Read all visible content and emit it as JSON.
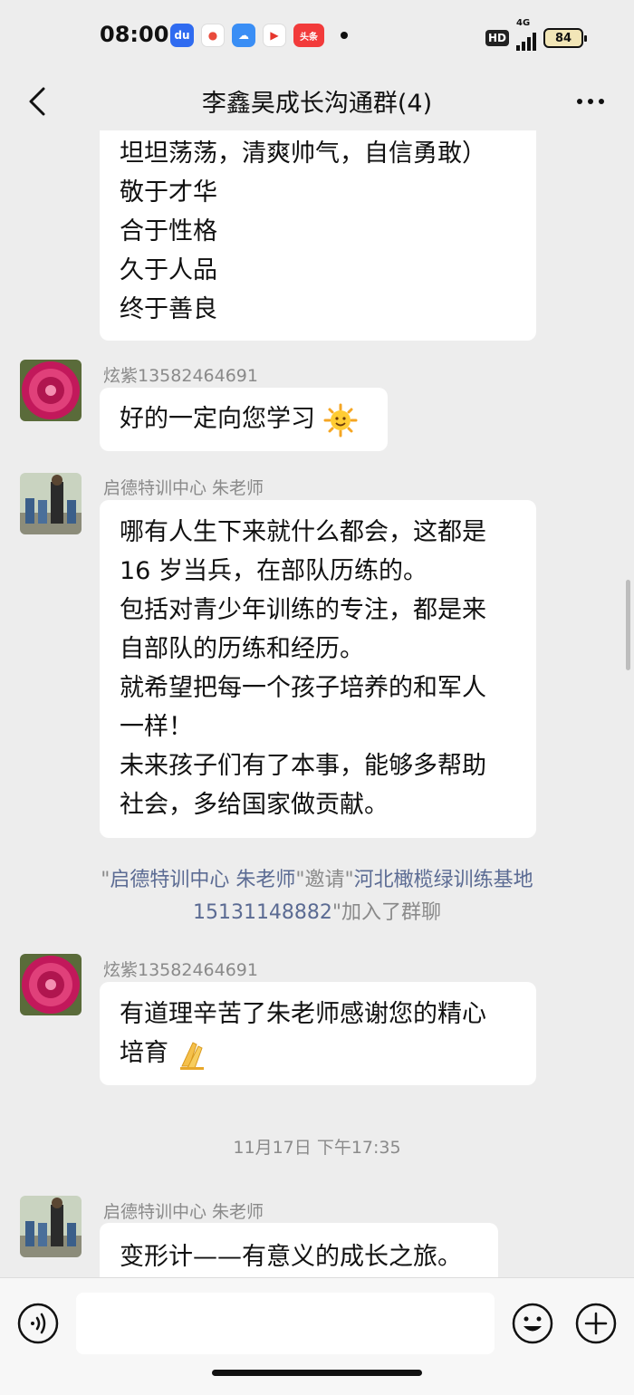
{
  "status_bar": {
    "time": "08:00",
    "app_icons": [
      {
        "name": "baidu-icon",
        "color": "#2f6bf0",
        "glyph": "du"
      },
      {
        "name": "map-pin-icon",
        "color": "#e94b3c",
        "glyph": "●"
      },
      {
        "name": "weather-icon",
        "color": "#3a8ef5",
        "glyph": "☁"
      },
      {
        "name": "video-icon",
        "color": "#e6362d",
        "glyph": "▶"
      },
      {
        "name": "toutiao-icon",
        "color": "#f23b3b",
        "glyph": "头条"
      }
    ],
    "hd_label": "HD",
    "network_label": "4G",
    "battery": "84"
  },
  "nav": {
    "title": "李鑫昊成长沟通群(4)"
  },
  "messages": {
    "m0": {
      "lines": [
        "坦坦荡荡，清爽帅气，自信勇敢）",
        "敬于才华",
        "合于性格",
        "久于人品",
        "终于善良"
      ]
    },
    "m1": {
      "sender": "炫紫13582464691",
      "text": "好的一定向您学习",
      "emoji": "sun-emoji"
    },
    "m2": {
      "sender": "启德特训中心  朱老师",
      "lines": [
        "哪有人生下来就什么都会，这都是",
        "16 岁当兵，在部队历练的。",
        "包括对青少年训练的专注，都是来",
        "自部队的历练和经历。",
        "就希望把每一个孩子培养的和军人",
        "一样！",
        "未来孩子们有了本事，能够多帮助",
        "社会，多给国家做贡献。"
      ]
    },
    "system": {
      "q1": "\"",
      "inviter": "启德特训中心  朱老师",
      "mid": "\"邀请\"",
      "invitee_line1": "河北橄榄绿训练基地",
      "invitee_line2": "15131148882",
      "end": "\"加入了群聊"
    },
    "m3": {
      "sender": "炫紫13582464691",
      "line1": "有道理辛苦了朱老师感谢您的精心",
      "line2": "培育",
      "emoji": "pray-hands-emoji"
    },
    "timestamp": "11月17日 下午17:35",
    "m4": {
      "sender": "启德特训中心  朱老师",
      "text": "变形计——有意义的成长之旅。"
    }
  },
  "input": {
    "placeholder": ""
  },
  "colors": {
    "background": "#ededed",
    "bubble": "#ffffff",
    "meta_text": "#8a8a8a",
    "link": "#5b6b93"
  }
}
